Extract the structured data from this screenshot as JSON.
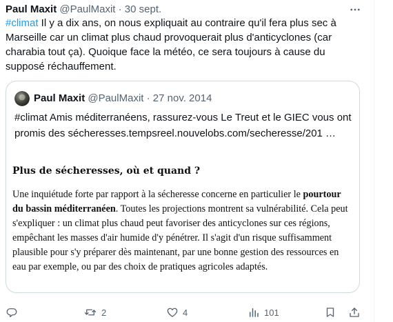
{
  "tweet": {
    "author_name": "Paul Maxit",
    "handle": "@PaulMaxit",
    "separator": "·",
    "date": "30 sept.",
    "hashtag": "#climat",
    "text": " Il y a dix ans, on nous expliquait au contraire qu'il fera plus sec à Marseille car un climat plus chaud provoquerait plus d'anticyclones (car charabia tout ça). Quoique face la météo, ce sera toujours à cause du supposé réchauffement."
  },
  "quoted": {
    "author_name": "Paul Maxit",
    "handle": "@PaulMaxit",
    "separator": "·",
    "date": "27 nov. 2014",
    "text": "#climat Amis méditerranéens, rassurez-vous Le Treut et le GIEC vous ont promis des sécheresses.tempsreel.nouvelobs.com/secheresse/201 …",
    "article": {
      "title": "Plus de sécheresses, où et quand ?",
      "body_start": "Une inquiétude forte par rapport à la sécheresse concerne en particulier le ",
      "body_bold": "pourtour du bassin méditerranéen",
      "body_end": ". Toutes les projections montrent sa vulnérabilité. Cela peut s'expliquer : un climat plus chaud peut favoriser des anticyclones sur ces régions, empêchant les masses d'air humide d'y pénétrer. Il s'agit d'un risque suffisamment plausible pour s'y préparer dès maintenant, par une bonne gestion des ressources en eau par exemple, ou par des choix de pratiques agricoles adaptés."
    }
  },
  "actions": {
    "replies": "",
    "retweets": "2",
    "likes": "4",
    "views": "101"
  },
  "colors": {
    "link": "#1d9bf0",
    "muted": "#536471",
    "border": "#cfd9de"
  }
}
